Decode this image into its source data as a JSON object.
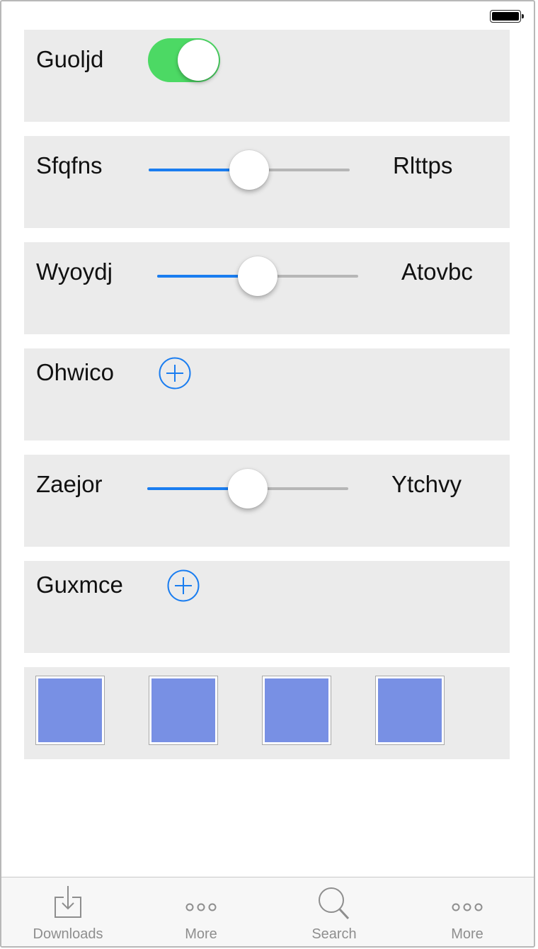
{
  "colors": {
    "row_bg": "#ebebeb",
    "toggle_on": "#4cd964",
    "accent": "#1a7df0",
    "track": "#b6b6b6",
    "swatch": "#7890e4",
    "tab_inactive": "#8e8e8e"
  },
  "status_bar": {
    "battery_icon": "battery-full-icon"
  },
  "rows": {
    "toggle_row": {
      "label": "Guoljd",
      "toggle_on": true
    },
    "slider_1": {
      "label_left": "Sfqfns",
      "label_right": "Rlttps",
      "value": 0.5
    },
    "slider_2": {
      "label_left": "Wyoydj",
      "label_right": "Atovbc",
      "value": 0.5
    },
    "add_row_1": {
      "label": "Ohwico",
      "icon": "add-circle-icon"
    },
    "slider_3": {
      "label_left": "Zaejor",
      "label_right": "Ytchvy",
      "value": 0.5
    },
    "add_row_2": {
      "label": "Guxmce",
      "icon": "add-circle-icon"
    },
    "swatch_row": {
      "count": 4,
      "color": "#7890e4"
    }
  },
  "tab_bar": {
    "items": [
      {
        "label": "Downloads",
        "icon": "downloads-icon"
      },
      {
        "label": "More",
        "icon": "more-icon"
      },
      {
        "label": "Search",
        "icon": "search-icon"
      },
      {
        "label": "More",
        "icon": "more-icon"
      }
    ]
  }
}
